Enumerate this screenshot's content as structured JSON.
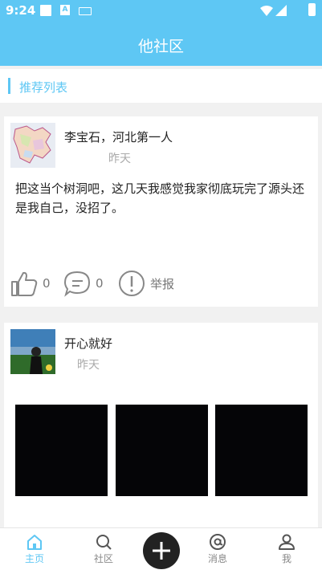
{
  "status": {
    "time": "9:24",
    "badge": "A"
  },
  "header": {
    "title": "他社区"
  },
  "section": {
    "label": "推荐列表"
  },
  "posts": [
    {
      "author": "李宝石，河北第一人",
      "date": "昨天",
      "text": "把这当个树洞吧，这几天我感觉我家彻底玩完了源头还是我自己，没招了。",
      "likes": "0",
      "comments": "0",
      "report_label": "举报"
    },
    {
      "author": "开心就好",
      "date": "昨天"
    }
  ],
  "tabs": [
    {
      "label": "主页",
      "icon": "home-icon"
    },
    {
      "label": "社区",
      "icon": "search-icon"
    },
    {
      "label": "消息",
      "icon": "at-icon"
    },
    {
      "label": "我",
      "icon": "person-icon"
    }
  ],
  "colors": {
    "accent": "#5ec7f4",
    "fab": "#222222"
  }
}
